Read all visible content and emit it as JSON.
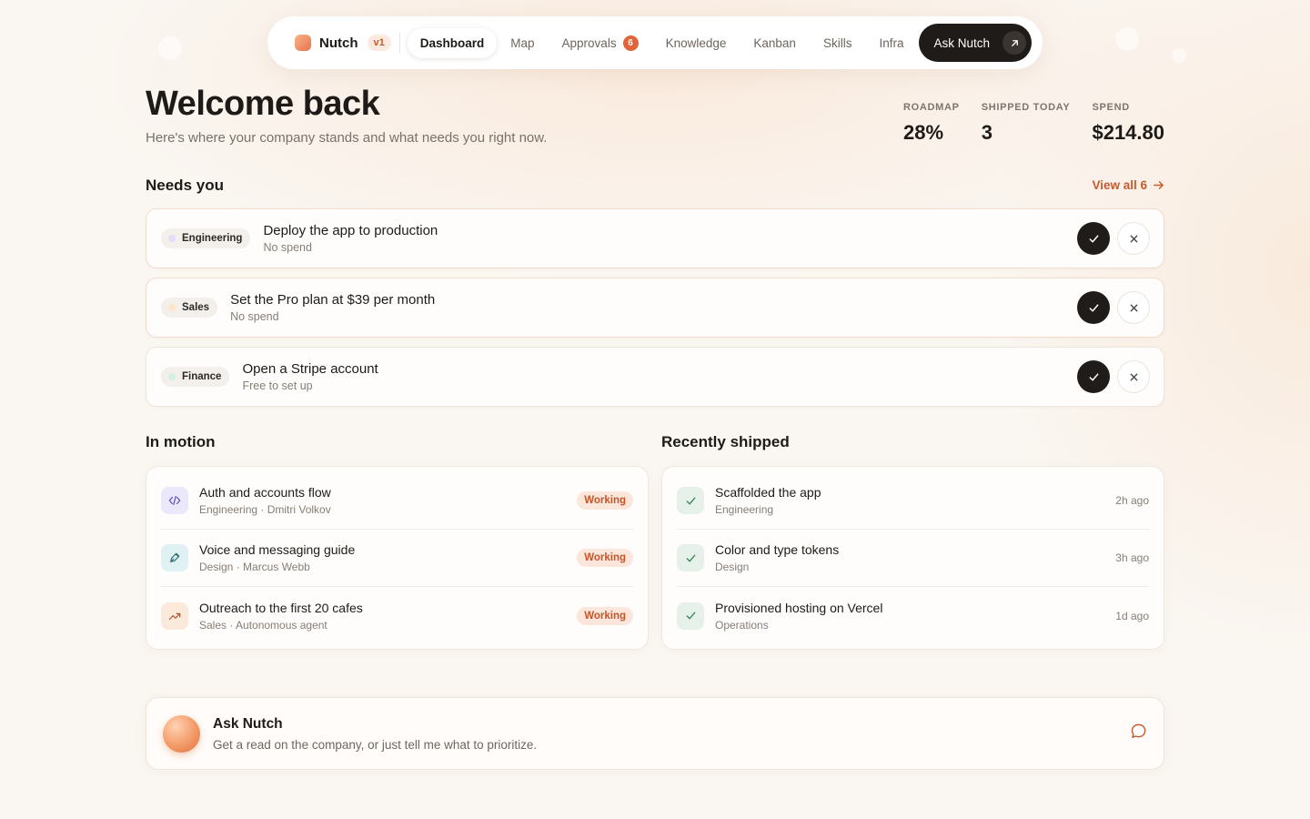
{
  "nav": {
    "brand": "Nutch",
    "version": "v1",
    "tabs": [
      {
        "label": "Dashboard",
        "active": true
      },
      {
        "label": "Map"
      },
      {
        "label": "Approvals",
        "badge": "6"
      },
      {
        "label": "Knowledge"
      },
      {
        "label": "Kanban"
      },
      {
        "label": "Skills"
      },
      {
        "label": "Infra"
      }
    ],
    "ask_button": "Ask Nutch"
  },
  "header": {
    "title": "Welcome back",
    "subtitle": "Here's where your company stands and what needs you right now."
  },
  "stats": [
    {
      "label": "ROADMAP",
      "value": "28%"
    },
    {
      "label": "SHIPPED TODAY",
      "value": "3"
    },
    {
      "label": "SPEND",
      "value": "$214.80"
    }
  ],
  "needs_you": {
    "title": "Needs you",
    "view_all": "View all 6",
    "items": [
      {
        "dept": "Engineering",
        "dept_color": "#e3dcfb",
        "title": "Deploy the app to production",
        "sub": "No spend"
      },
      {
        "dept": "Sales",
        "dept_color": "#fbe7c9",
        "title": "Set the Pro plan at $39 per month",
        "sub": "No spend"
      },
      {
        "dept": "Finance",
        "dept_color": "#d6efe4",
        "title": "Open a Stripe account",
        "sub": "Free to set up"
      }
    ]
  },
  "in_motion": {
    "title": "In motion",
    "items": [
      {
        "icon": "code-icon",
        "icon_bg": "#ece8fb",
        "title": "Auth and accounts flow",
        "sub": "Engineering · Dmitri Volkov",
        "status": "Working"
      },
      {
        "icon": "pen-icon",
        "icon_bg": "#dff1f2",
        "title": "Voice and messaging guide",
        "sub": "Design · Marcus Webb",
        "status": "Working"
      },
      {
        "icon": "trend-up-icon",
        "icon_bg": "#fbeadb",
        "title": "Outreach to the first 20 cafes",
        "sub": "Sales · Autonomous agent",
        "status": "Working"
      }
    ]
  },
  "recently_shipped": {
    "title": "Recently shipped",
    "items": [
      {
        "title": "Scaffolded the app",
        "sub": "Engineering",
        "time": "2h ago"
      },
      {
        "title": "Color and type tokens",
        "sub": "Design",
        "time": "3h ago"
      },
      {
        "title": "Provisioned hosting on Vercel",
        "sub": "Operations",
        "time": "1d ago"
      }
    ]
  },
  "ask_card": {
    "title": "Ask Nutch",
    "sub": "Get a read on the company, or just tell me what to prioritize."
  },
  "colors": {
    "accent": "#c55b2e",
    "dark": "#1f1b18",
    "check_bg": "#e6f1ea"
  }
}
